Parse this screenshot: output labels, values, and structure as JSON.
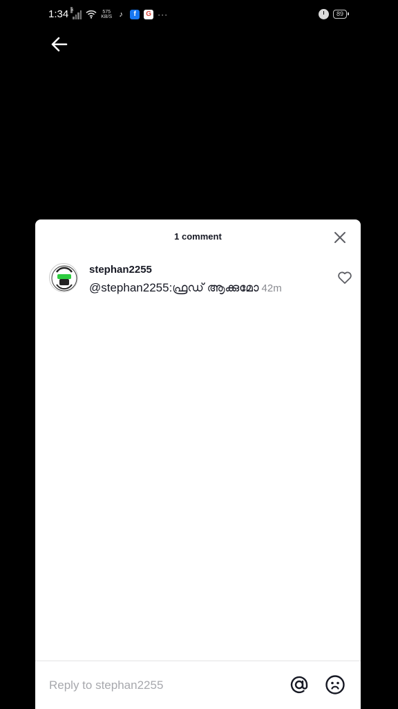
{
  "status_bar": {
    "time": "1:34",
    "net_speed_value": "575",
    "net_speed_unit": "KB/S",
    "battery": "89",
    "notification_icons": [
      "tiktok-icon",
      "facebook-icon",
      "google-icon"
    ]
  },
  "sheet": {
    "title": "1 comment",
    "comments": [
      {
        "username": "stephan2255",
        "text": "@stephan2255:ഫ്രഡ് ആക്കുമോ",
        "time": "42m"
      }
    ]
  },
  "reply": {
    "placeholder": "Reply to stephan2255"
  },
  "colors": {
    "background": "#000000",
    "sheet": "#ffffff",
    "text_primary": "#161823",
    "text_secondary": "#8a8b91",
    "avatar_accent": "#2ecc40"
  }
}
